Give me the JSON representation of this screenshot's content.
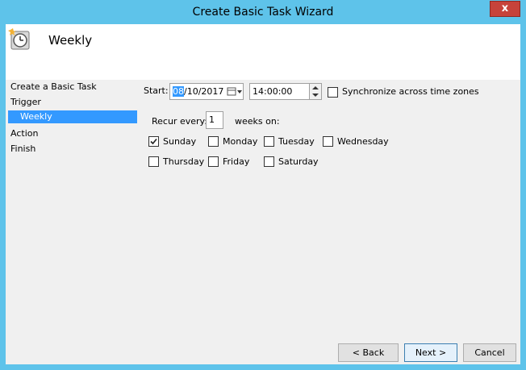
{
  "window": {
    "title": "Create Basic Task Wizard",
    "close_label": "x"
  },
  "header": {
    "title": "Weekly",
    "icon": "task-clock-icon"
  },
  "nav": {
    "items": [
      "Create a Basic Task",
      "Trigger",
      "Weekly",
      "Action",
      "Finish"
    ],
    "selected": "Weekly"
  },
  "start": {
    "label": "Start:",
    "date_selected": "08",
    "date_rest": "/10/2017",
    "time": "14:00:00",
    "sync_label": "Synchronize across time zones",
    "sync_checked": false
  },
  "recur": {
    "label": "Recur every:",
    "value": "1",
    "suffix": "weeks on:"
  },
  "days": [
    {
      "label": "Sunday",
      "checked": true
    },
    {
      "label": "Monday",
      "checked": false
    },
    {
      "label": "Tuesday",
      "checked": false
    },
    {
      "label": "Wednesday",
      "checked": false
    },
    {
      "label": "Thursday",
      "checked": false
    },
    {
      "label": "Friday",
      "checked": false
    },
    {
      "label": "Saturday",
      "checked": false
    }
  ],
  "buttons": {
    "back": "< Back",
    "next": "Next >",
    "cancel": "Cancel"
  },
  "colors": {
    "titlebar": "#5ec3ea",
    "selection": "#3399ff",
    "close": "#c7433a"
  }
}
